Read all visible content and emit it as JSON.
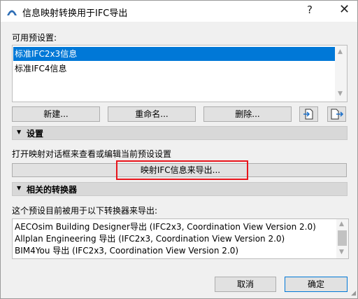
{
  "window": {
    "title": "信息映射转换用于IFC导出",
    "help_label": "?",
    "close_label": "✕"
  },
  "presets": {
    "label": "可用预设置:",
    "items": [
      {
        "label": "标准IFC2x3信息",
        "selected": true
      },
      {
        "label": "标准IFC4信息",
        "selected": false
      }
    ]
  },
  "buttons": {
    "new": "新建...",
    "rename": "重命名...",
    "delete": "删除...",
    "import_icon": "import-icon",
    "export_icon": "export-icon"
  },
  "settings": {
    "title": "设置",
    "description": "打开映射对话框来查看或编辑当前预设设置",
    "map_button": "映射IFC信息来导出..."
  },
  "converters": {
    "title": "相关的转换器",
    "description": "这个预设目前被用于以下转换器来导出:",
    "items": [
      "AECOsim Building Designer导出 (IFC2x3, Coordination View Version 2.0)",
      "Allplan Engineering 导出 (IFC2x3, Coordination View Version 2.0)",
      "BIM4You 导出 (IFC2x3, Coordination View Version 2.0)"
    ]
  },
  "footer": {
    "cancel": "取消",
    "ok": "确定"
  },
  "colors": {
    "selection": "#0078d7",
    "highlight": "#e8141b"
  }
}
